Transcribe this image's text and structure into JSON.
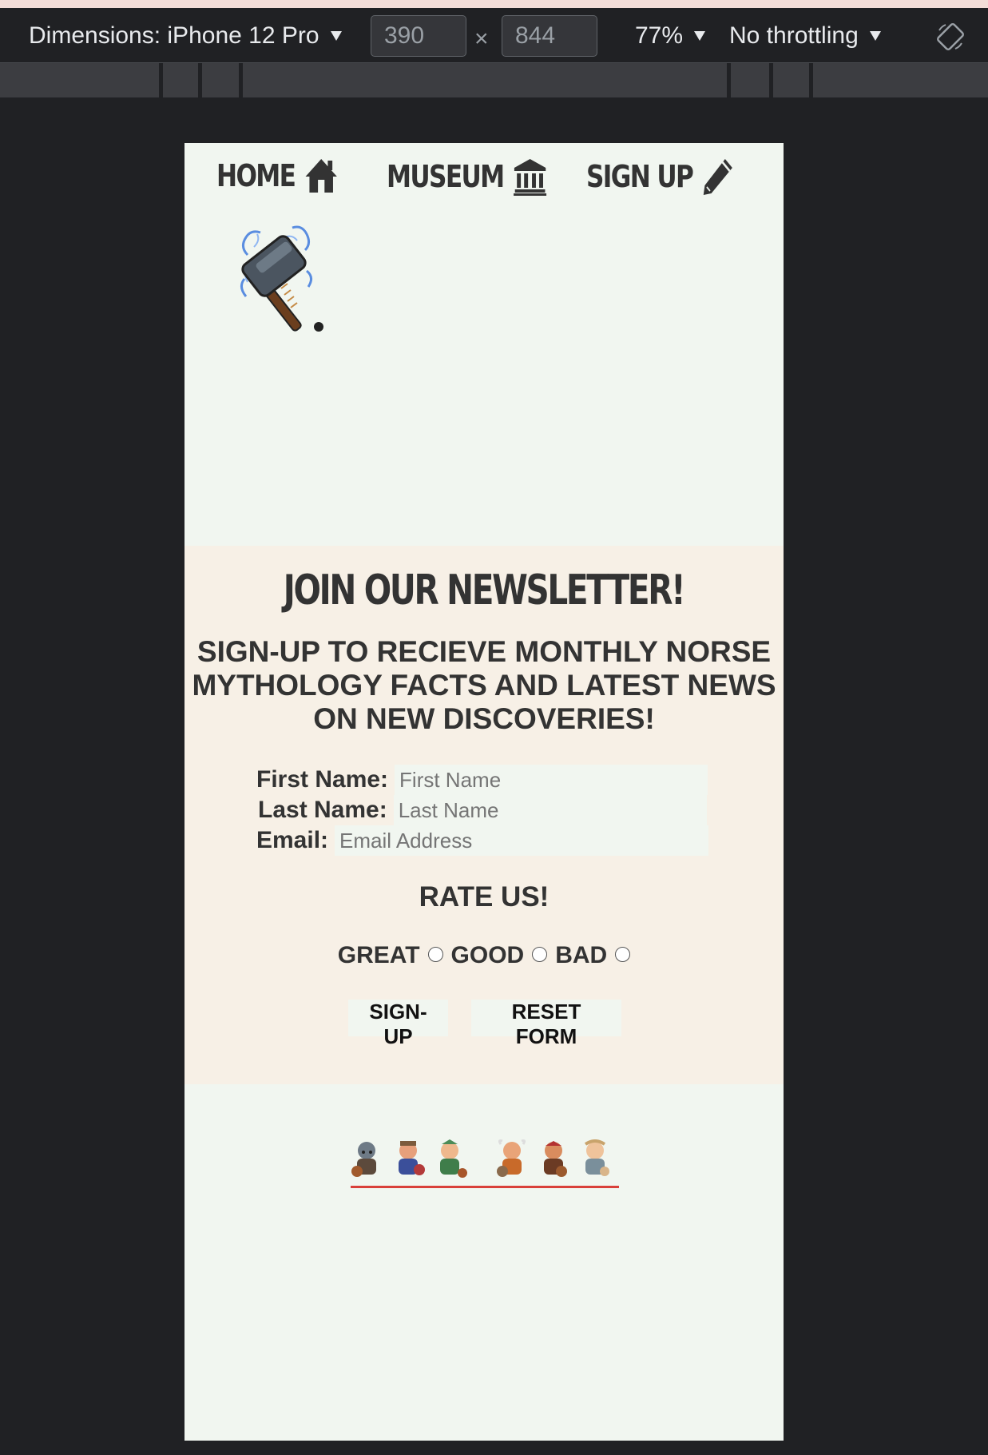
{
  "devtools": {
    "dimensions_label": "Dimensions: iPhone 12 Pro",
    "width_value": "390",
    "height_value": "844",
    "times": "×",
    "zoom": "77%",
    "throttling": "No throttling",
    "rotate_icon": "rotate-icon"
  },
  "nav": {
    "items": [
      {
        "label": "HOME",
        "icon": "home-icon"
      },
      {
        "label": "MUSEUM",
        "icon": "museum-icon"
      },
      {
        "label": "SIGN UP",
        "icon": "pencil-icon"
      }
    ]
  },
  "newsletter": {
    "title": "JOIN OUR NEWSLETTER!",
    "subtitle_line1": "SIGN-UP TO RECIEVE MONTHLY NORSE",
    "subtitle_line2": "MYTHOLOGY FACTS AND LATEST NEWS",
    "subtitle_line3": "ON NEW DISCOVERIES!",
    "first_name_label": "First Name:",
    "first_name_placeholder": "First Name",
    "last_name_label": "Last Name:",
    "last_name_placeholder": "Last Name",
    "email_label": "Email:",
    "email_placeholder": "Email Address",
    "rate_title": "RATE US!",
    "ratings": [
      "GREAT",
      "GOOD",
      "BAD"
    ],
    "signup_button": "SIGN-UP",
    "reset_button": "RESET FORM"
  },
  "colors": {
    "page_bg": "#f1f6f0",
    "newsletter_bg": "#f7f0e6",
    "text": "#333333",
    "accent_underline": "#d9403a"
  }
}
